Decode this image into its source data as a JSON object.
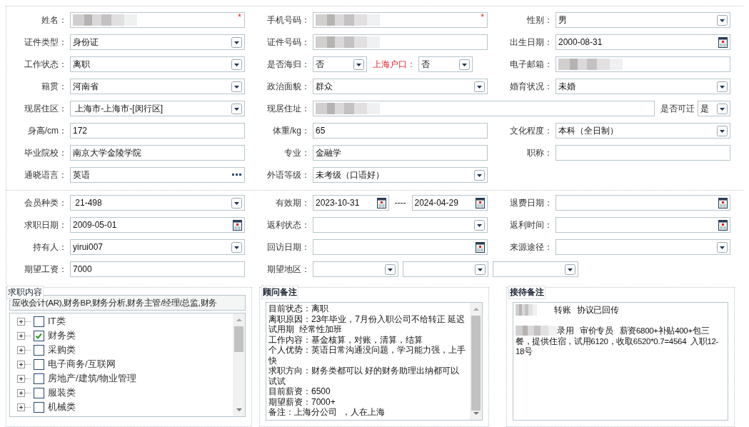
{
  "profile_section": {
    "rows": [
      {
        "cells": [
          {
            "parts": [
              {
                "kind": "label",
                "text": "姓名："
              },
              {
                "kind": "text",
                "redacted": true,
                "required_mark": "*"
              }
            ]
          },
          {
            "parts": [
              {
                "kind": "label",
                "text": "手机号码："
              },
              {
                "kind": "text",
                "redacted": true,
                "required_mark": "*"
              }
            ]
          },
          {
            "parts": [
              {
                "kind": "label",
                "text": "性别："
              },
              {
                "kind": "select",
                "value": "男"
              }
            ]
          }
        ]
      },
      {
        "cells": [
          {
            "parts": [
              {
                "kind": "label",
                "text": "证件类型："
              },
              {
                "kind": "select",
                "value": "身份证"
              }
            ]
          },
          {
            "parts": [
              {
                "kind": "label",
                "text": "证件号码："
              },
              {
                "kind": "text",
                "redacted": true
              }
            ]
          },
          {
            "parts": [
              {
                "kind": "label",
                "text": "出生日期："
              },
              {
                "kind": "date",
                "value": "2000-08-31"
              }
            ]
          }
        ]
      },
      {
        "cells": [
          {
            "parts": [
              {
                "kind": "label",
                "text": "工作状态："
              },
              {
                "kind": "select",
                "value": "离职"
              }
            ]
          },
          {
            "parts": [
              {
                "kind": "label",
                "text": "是否海归："
              },
              {
                "kind": "mini-select",
                "value": "否"
              },
              {
                "kind": "alert-label",
                "text": "上海户口："
              },
              {
                "kind": "mini-select",
                "value": "否"
              }
            ]
          },
          {
            "parts": [
              {
                "kind": "label",
                "text": "电子邮箱："
              },
              {
                "kind": "text",
                "redacted": true
              }
            ]
          }
        ]
      },
      {
        "cells": [
          {
            "parts": [
              {
                "kind": "label",
                "text": "籍贯："
              },
              {
                "kind": "select",
                "value": "河南省"
              }
            ]
          },
          {
            "parts": [
              {
                "kind": "label",
                "text": "政治面貌："
              },
              {
                "kind": "select",
                "value": "群众"
              }
            ]
          },
          {
            "parts": [
              {
                "kind": "label",
                "text": "婚育状况："
              },
              {
                "kind": "select",
                "value": "未婚"
              }
            ]
          }
        ]
      },
      {
        "cells": [
          {
            "parts": [
              {
                "kind": "label",
                "text": "现居住区："
              },
              {
                "kind": "select",
                "value": " 上海市-上海市-[闵行区]"
              }
            ]
          },
          {
            "parts": [
              {
                "kind": "label",
                "text": "现居住址："
              },
              {
                "kind": "text",
                "redacted": true
              },
              {
                "kind": "label",
                "text": "是否可迁"
              },
              {
                "kind": "narrow-select",
                "value": "是"
              }
            ]
          }
        ]
      },
      {
        "cells": [
          {
            "parts": [
              {
                "kind": "label",
                "text": "身高/cm："
              },
              {
                "kind": "text",
                "value": "172"
              }
            ]
          },
          {
            "parts": [
              {
                "kind": "label",
                "text": "体重/kg："
              },
              {
                "kind": "text",
                "value": "65"
              }
            ]
          },
          {
            "parts": [
              {
                "kind": "label",
                "text": "文化程度："
              },
              {
                "kind": "select",
                "value": "本科（全日制）"
              }
            ]
          }
        ]
      },
      {
        "cells": [
          {
            "parts": [
              {
                "kind": "label",
                "text": "毕业院校："
              },
              {
                "kind": "text",
                "value": "南京大学金陵学院"
              }
            ]
          },
          {
            "parts": [
              {
                "kind": "label",
                "text": "专业："
              },
              {
                "kind": "text",
                "value": "金融学"
              }
            ]
          },
          {
            "parts": [
              {
                "kind": "label",
                "text": "职称："
              },
              {
                "kind": "text"
              }
            ]
          }
        ]
      },
      {
        "cells": [
          {
            "parts": [
              {
                "kind": "label",
                "text": "通晓语言："
              },
              {
                "kind": "lookup",
                "value": "英语"
              }
            ]
          },
          {
            "parts": [
              {
                "kind": "label",
                "text": "外语等级："
              },
              {
                "kind": "select",
                "value": "未考级（口语好）"
              }
            ]
          }
        ]
      }
    ]
  },
  "member_section": {
    "rows": [
      {
        "cells": [
          {
            "parts": [
              {
                "kind": "label",
                "text": "会员种类："
              },
              {
                "kind": "select",
                "value": " 21-498"
              }
            ]
          },
          {
            "parts": [
              {
                "kind": "label",
                "text": "有效期："
              },
              {
                "kind": "date",
                "value": "2023-10-31"
              },
              {
                "kind": "separator",
                "text": "----"
              },
              {
                "kind": "date",
                "value": "2024-04-29"
              }
            ]
          },
          {
            "parts": [
              {
                "kind": "label",
                "text": "退费日期："
              },
              {
                "kind": "date"
              }
            ]
          }
        ]
      },
      {
        "cells": [
          {
            "parts": [
              {
                "kind": "label",
                "text": "求职日期："
              },
              {
                "kind": "date",
                "value": "2009-05-01"
              }
            ]
          },
          {
            "parts": [
              {
                "kind": "label",
                "text": "返利状态："
              },
              {
                "kind": "select"
              }
            ]
          },
          {
            "parts": [
              {
                "kind": "label",
                "text": "返利时间："
              },
              {
                "kind": "date"
              }
            ]
          }
        ]
      },
      {
        "cells": [
          {
            "parts": [
              {
                "kind": "label",
                "text": "持有人："
              },
              {
                "kind": "select",
                "value": "yirui007"
              }
            ]
          },
          {
            "parts": [
              {
                "kind": "label",
                "text": "回访日期："
              },
              {
                "kind": "date"
              }
            ]
          },
          {
            "parts": [
              {
                "kind": "label",
                "text": "来源途径："
              },
              {
                "kind": "select"
              }
            ]
          }
        ]
      },
      {
        "cells": [
          {
            "parts": [
              {
                "kind": "label",
                "text": "期望工资："
              },
              {
                "kind": "text",
                "value": "7000"
              }
            ]
          },
          {
            "parts": [
              {
                "kind": "label",
                "text": "期望地区："
              },
              {
                "kind": "short-select"
              },
              {
                "kind": "short-select"
              },
              {
                "kind": "short-select"
              }
            ]
          }
        ]
      }
    ]
  },
  "job_content": {
    "legend": "求职内容",
    "summary": "应收会计(AR),财务BP,财务分析,财务主管/经理/总监,财务",
    "tree": [
      {
        "label": "IT类",
        "checked": false,
        "expanded": false
      },
      {
        "label": "财务类",
        "checked": true,
        "expanded": false
      },
      {
        "label": "采购类",
        "checked": false,
        "expanded": false
      },
      {
        "label": "电子商务/互联网",
        "checked": false,
        "expanded": false
      },
      {
        "label": "房地产/建筑/物业管理",
        "checked": false,
        "expanded": false
      },
      {
        "label": "服装类",
        "checked": false,
        "expanded": false
      },
      {
        "label": "机械类",
        "checked": false,
        "expanded": false
      }
    ]
  },
  "consultant_notes": {
    "legend": "顾问备注",
    "lines": [
      "目前状态：离职",
      "离职原因：23年毕业，7月份入职公司不给转正 延迟试用期  经常性加班",
      "工作内容：基金核算，对账，清算，结算",
      "个人优势：英语日常沟通没问题，学习能力强，上手快",
      "求职方向：财务类都可以 好的财务助理出纳都可以试试",
      "目前薪资：6500",
      "期望薪资：7000+",
      "备注：上海分公司  ，人在上海"
    ]
  },
  "reception_notes": {
    "legend": "接待备注",
    "paragraphs": [
      {
        "redacted": true,
        "lines": [
          "转账   协议已回传"
        ]
      },
      {
        "redacted": true,
        "lines": [
          "录用   审价专员   薪资6800+补贴400+包三",
          "餐，提供住宿，试用6120，收取6520*0.7=4564  入职12-18号"
        ]
      }
    ]
  }
}
